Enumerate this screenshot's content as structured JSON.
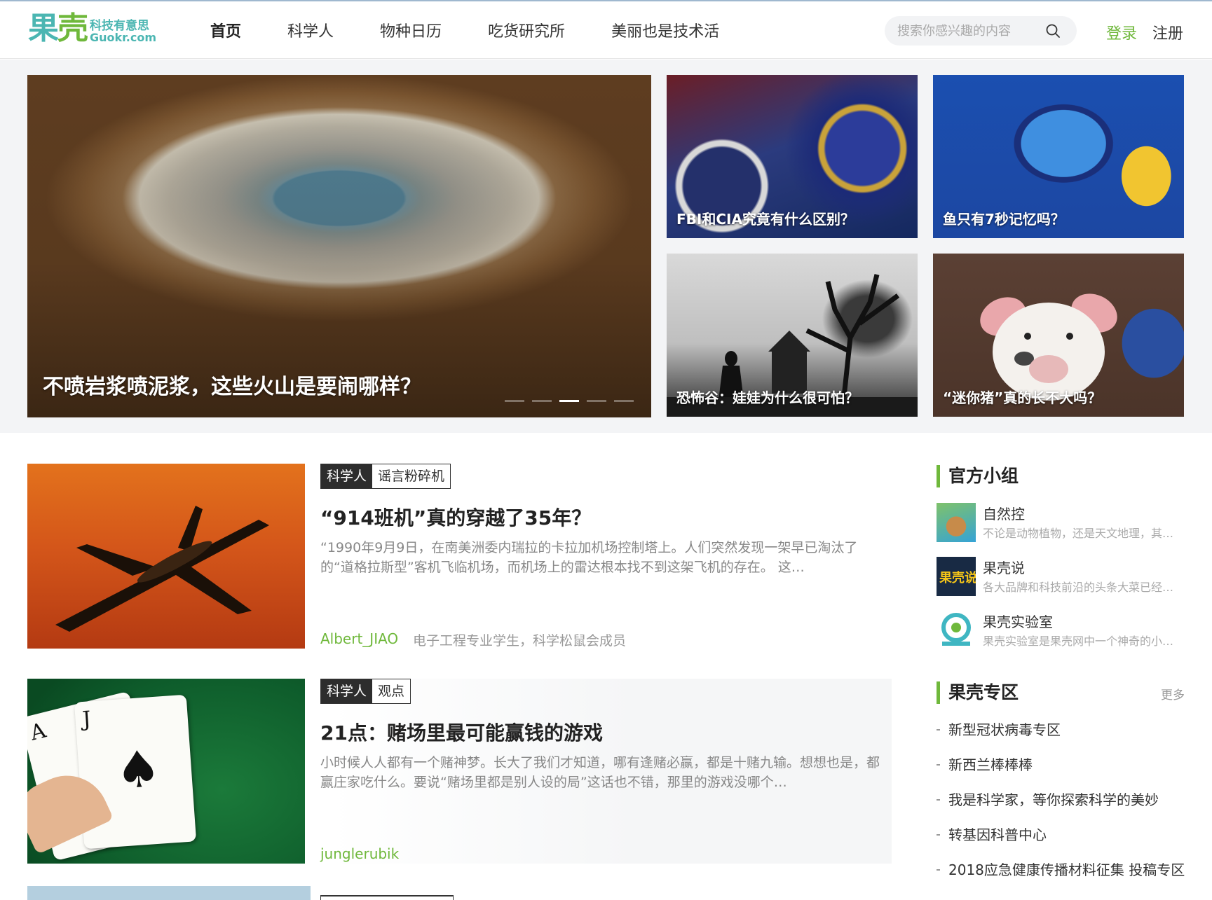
{
  "header": {
    "logo_cn_left": "果",
    "logo_cn_right": "壳",
    "logo_slogan": "科技有意思",
    "logo_domain": "Guokr.com",
    "nav": [
      {
        "label": "首页",
        "active": true
      },
      {
        "label": "科学人",
        "active": false
      },
      {
        "label": "物种日历",
        "active": false
      },
      {
        "label": "吃货研究所",
        "active": false
      },
      {
        "label": "美丽也是技术活",
        "active": false
      }
    ],
    "search_placeholder": "搜索你感兴趣的内容",
    "login": "登录",
    "register": "注册"
  },
  "hero": {
    "main_title": "不喷岩浆喷泥浆，这些火山是要闹哪样？",
    "active_dot": 3,
    "dot_count": 5,
    "tiles": [
      {
        "title": "FBI和CIA究竟有什么区别？"
      },
      {
        "title": "鱼只有7秒记忆吗？"
      },
      {
        "title": "恐怖谷：娃娃为什么很可怕？"
      },
      {
        "title": "“迷你猪”真的长不大吗？"
      }
    ]
  },
  "articles": [
    {
      "tag_channel": "科学人",
      "tag_topic": "谣言粉碎机",
      "title": "“914班机”真的穿越了35年？",
      "summary": "“1990年9月9日，在南美洲委内瑞拉的卡拉加机场控制塔上。人们突然发现一架早已淘汰了的“道格拉斯型”客机飞临机场，而机场上的雷达根本找不到这架飞机的存在。 这…",
      "author": "Albert_JIAO",
      "author_bio": "电子工程专业学生，科学松鼠会成员"
    },
    {
      "tag_channel": "科学人",
      "tag_topic": "观点",
      "title": "21点：赌场里最可能赢钱的游戏",
      "summary": "小时候人人都有一个赌神梦。长大了我们才知道，哪有逢赌必赢，都是十赌九输。想想也是，都赢庄家吃什么。要说“赌场里都是别人设的局”这话也不错，那里的游戏没哪个…",
      "author": "junglerubik",
      "author_bio": ""
    }
  ],
  "sidebar": {
    "official_groups_title": "官方小组",
    "groups": [
      {
        "name": "自然控",
        "desc": "不论是动物植物，还是天文地理，其…"
      },
      {
        "name": "果壳说",
        "desc": "各大品牌和科技前沿的头条大菜已经…",
        "icon_text": "果壳说"
      },
      {
        "name": "果壳实验室",
        "desc": "果壳实验室是果壳网中一个神奇的小…"
      }
    ],
    "zone_title": "果壳专区",
    "more": "更多",
    "zones": [
      "新型冠状病毒专区",
      "新西兰棒棒棒",
      "我是科学家，等你探索科学的美妙",
      "转基因科普中心",
      "2018应急健康传播材料征集 投稿专区"
    ]
  },
  "colors": {
    "brand_green": "#6fb83b",
    "brand_teal": "#4bb6b2",
    "tag_dark": "#2d2d2d"
  }
}
